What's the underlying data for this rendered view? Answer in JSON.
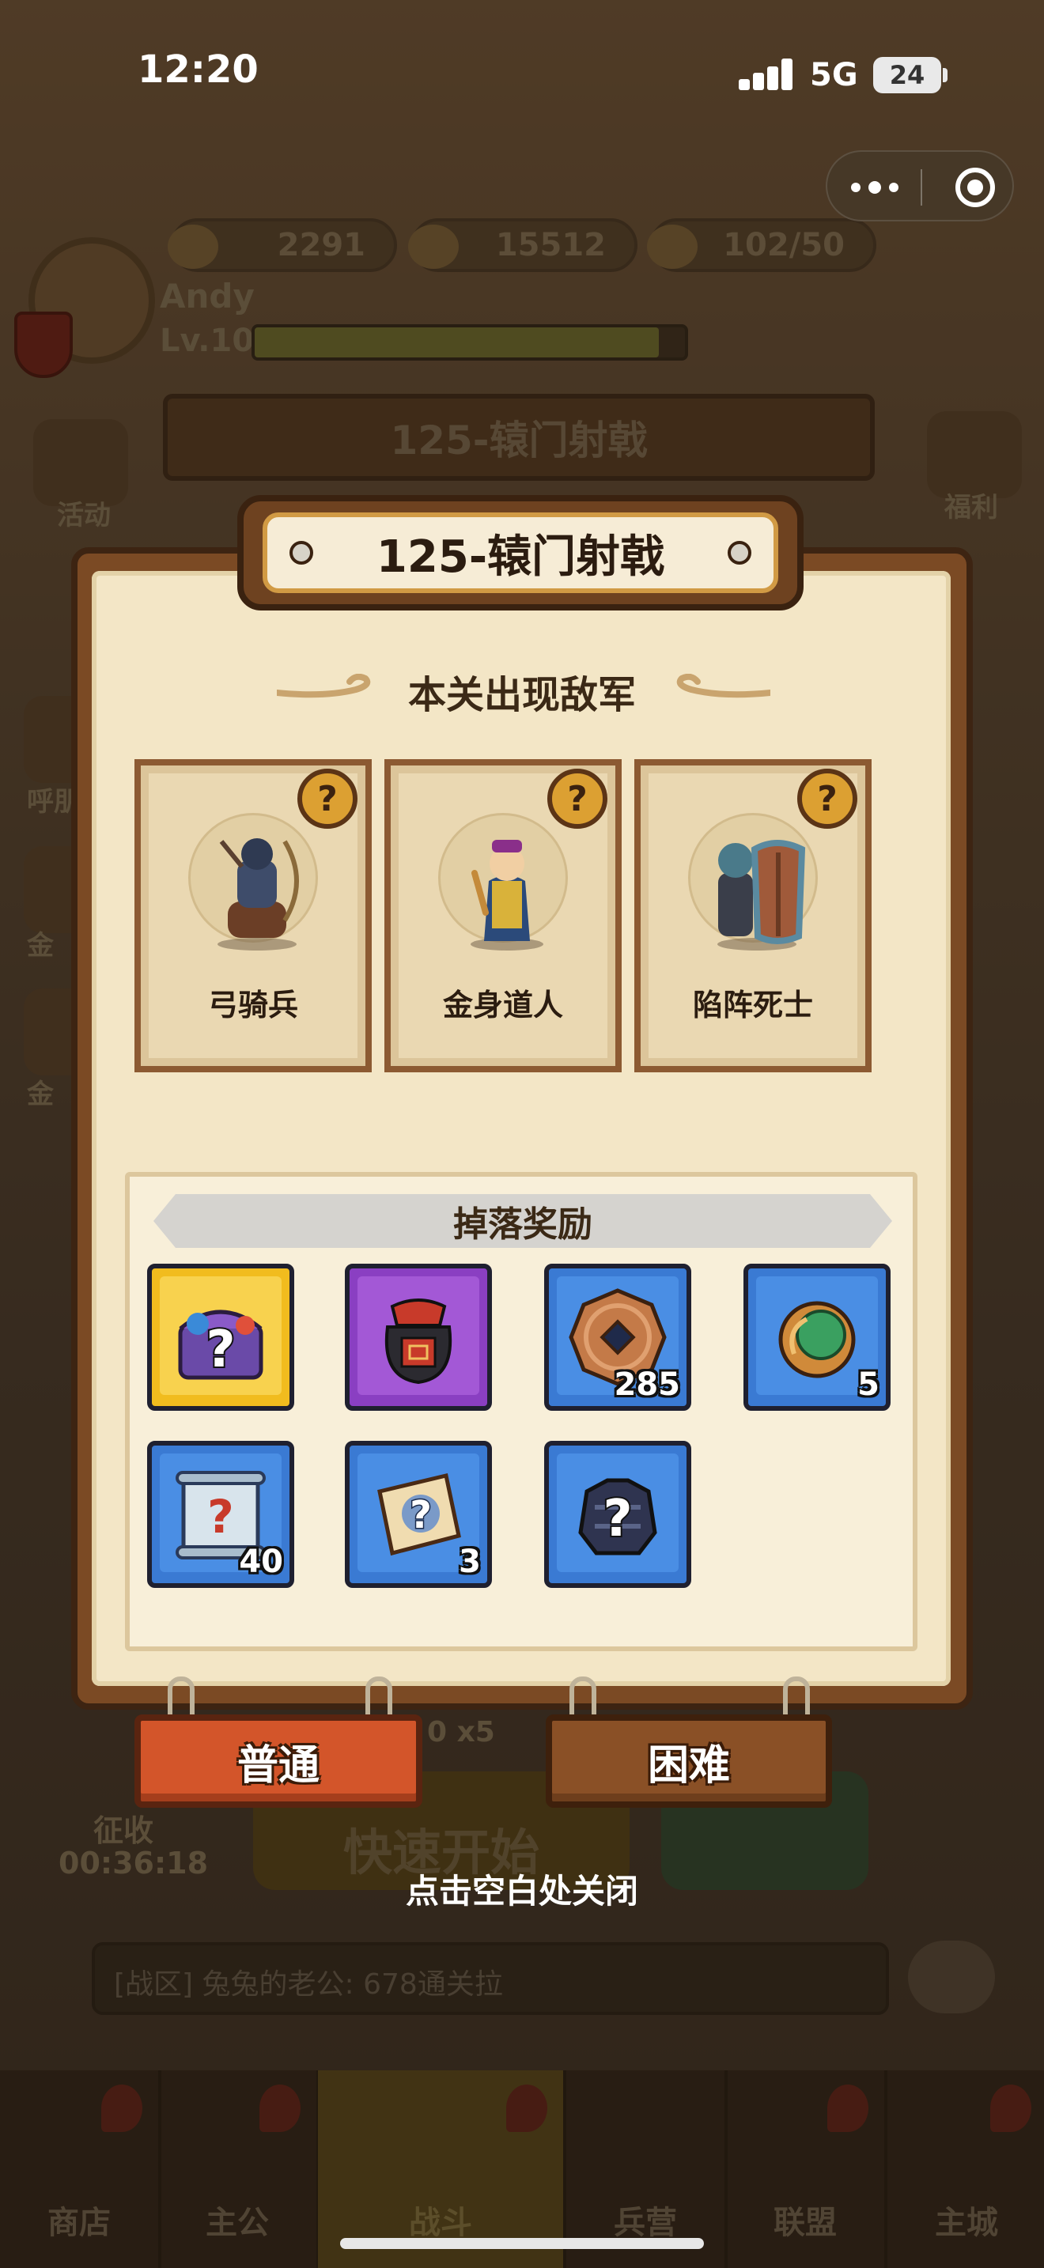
{
  "status_bar": {
    "time": "12:20",
    "network": "5G",
    "battery": "24"
  },
  "background": {
    "resources": [
      {
        "icon": "ingot-icon",
        "value": "2291"
      },
      {
        "icon": "coin-icon",
        "value": "15512"
      },
      {
        "icon": "food-icon",
        "value": "102/50"
      }
    ],
    "player": {
      "name": "Andy",
      "level": "Lv.106",
      "xp_fraction": 0.94
    },
    "stage_sign": "125-辕门射戟",
    "left_menu": [
      "活动",
      "呼朋",
      "金",
      "金"
    ],
    "right_menu": [
      "福利"
    ],
    "speed_label": "0 x5",
    "quick_start": "快速开始",
    "conquest_label": "征收",
    "conquest_timer": "00:36:18",
    "chat": "[战区] 兔兔的老公: 678通关拉",
    "tabs": [
      "商店",
      "主公",
      "战斗",
      "兵营",
      "联盟",
      "主城"
    ],
    "active_tab": "战斗"
  },
  "modal": {
    "title": "125-辕门射戟",
    "enemies_heading": "本关出现敌军",
    "enemies": [
      {
        "name": "弓骑兵",
        "icon": "horse-archer-icon",
        "badge": "?"
      },
      {
        "name": "金身道人",
        "icon": "taoist-icon",
        "badge": "?"
      },
      {
        "name": "陷阵死士",
        "icon": "shield-soldier-icon",
        "badge": "?"
      }
    ],
    "drops_heading": "掉落奖励",
    "drops": [
      {
        "icon": "mystery-chest-icon",
        "rarity": "gold",
        "qty": ""
      },
      {
        "icon": "wine-jar-icon",
        "rarity": "purple",
        "qty": ""
      },
      {
        "icon": "copper-coin-icon",
        "rarity": "blue",
        "qty": "285"
      },
      {
        "icon": "jade-orb-icon",
        "rarity": "blue",
        "qty": "5"
      },
      {
        "icon": "mystery-scroll-icon",
        "rarity": "blue",
        "qty": "40"
      },
      {
        "icon": "map-scroll-icon",
        "rarity": "blue",
        "qty": "3"
      },
      {
        "icon": "mystery-armor-icon",
        "rarity": "blue",
        "qty": ""
      }
    ],
    "difficulty": {
      "normal": "普通",
      "hard": "困难"
    },
    "close_hint": "点击空白处关闭"
  }
}
